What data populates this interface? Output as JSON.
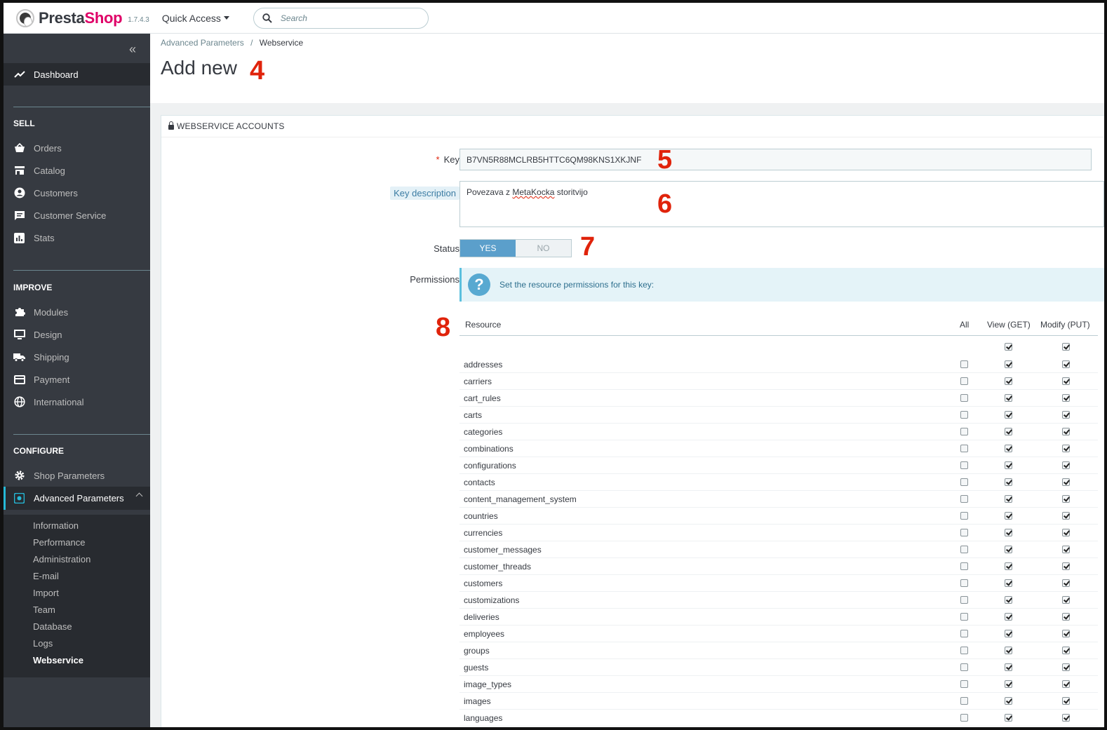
{
  "header": {
    "logo_main": "Presta",
    "logo_accent": "Shop",
    "version": "1.7.4.3",
    "quick_access": "Quick Access",
    "search_placeholder": "Search"
  },
  "sidebar": {
    "dashboard": "Dashboard",
    "sections": {
      "sell": "SELL",
      "improve": "IMPROVE",
      "configure": "CONFIGURE"
    },
    "sell_items": [
      "Orders",
      "Catalog",
      "Customers",
      "Customer Service",
      "Stats"
    ],
    "improve_items": [
      "Modules",
      "Design",
      "Shipping",
      "Payment",
      "International"
    ],
    "configure_items": [
      "Shop Parameters",
      "Advanced Parameters"
    ],
    "sub_items": [
      "Information",
      "Performance",
      "Administration",
      "E-mail",
      "Import",
      "Team",
      "Database",
      "Logs",
      "Webservice"
    ]
  },
  "breadcrumb": {
    "parent": "Advanced Parameters",
    "separator": "/",
    "current": "Webservice"
  },
  "page": {
    "title": "Add new"
  },
  "annotations": {
    "n4": "4",
    "n5": "5",
    "n6": "6",
    "n7": "7",
    "n8": "8"
  },
  "panel": {
    "title": "WEBSERVICE ACCOUNTS",
    "key_label": "Key",
    "required_mark": "*",
    "key_value": "B7VN5R88MCLRB5HTTC6QM98KNS1XKJNF",
    "desc_label": "Key description",
    "desc_value_pre": "Povezava z ",
    "desc_value_word": "MetaKocka",
    "desc_value_post": " storitvijo",
    "status_label": "Status",
    "status_yes": "YES",
    "status_no": "NO",
    "status_selected": "YES",
    "permissions_label": "Permissions",
    "permissions_help": "Set the resource permissions for this key:"
  },
  "permissions": {
    "columns": {
      "resource": "Resource",
      "all": "All",
      "view": "View (GET)",
      "modify": "Modify (PUT)"
    },
    "header_row": {
      "all": false,
      "view": true,
      "modify": true
    },
    "rows": [
      {
        "name": "addresses",
        "all": false,
        "view": true,
        "modify": true
      },
      {
        "name": "carriers",
        "all": false,
        "view": true,
        "modify": true
      },
      {
        "name": "cart_rules",
        "all": false,
        "view": true,
        "modify": true
      },
      {
        "name": "carts",
        "all": false,
        "view": true,
        "modify": true
      },
      {
        "name": "categories",
        "all": false,
        "view": true,
        "modify": true
      },
      {
        "name": "combinations",
        "all": false,
        "view": true,
        "modify": true
      },
      {
        "name": "configurations",
        "all": false,
        "view": true,
        "modify": true
      },
      {
        "name": "contacts",
        "all": false,
        "view": true,
        "modify": true
      },
      {
        "name": "content_management_system",
        "all": false,
        "view": true,
        "modify": true
      },
      {
        "name": "countries",
        "all": false,
        "view": true,
        "modify": true
      },
      {
        "name": "currencies",
        "all": false,
        "view": true,
        "modify": true
      },
      {
        "name": "customer_messages",
        "all": false,
        "view": true,
        "modify": true
      },
      {
        "name": "customer_threads",
        "all": false,
        "view": true,
        "modify": true
      },
      {
        "name": "customers",
        "all": false,
        "view": true,
        "modify": true
      },
      {
        "name": "customizations",
        "all": false,
        "view": true,
        "modify": true
      },
      {
        "name": "deliveries",
        "all": false,
        "view": true,
        "modify": true
      },
      {
        "name": "employees",
        "all": false,
        "view": true,
        "modify": true
      },
      {
        "name": "groups",
        "all": false,
        "view": true,
        "modify": true
      },
      {
        "name": "guests",
        "all": false,
        "view": true,
        "modify": true
      },
      {
        "name": "image_types",
        "all": false,
        "view": true,
        "modify": true
      },
      {
        "name": "images",
        "all": false,
        "view": true,
        "modify": true
      },
      {
        "name": "languages",
        "all": false,
        "view": true,
        "modify": true
      }
    ]
  }
}
